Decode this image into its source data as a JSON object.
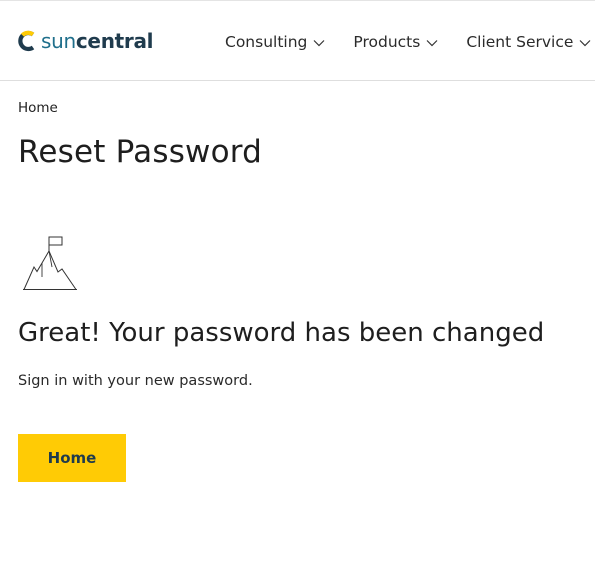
{
  "header": {
    "logo": {
      "text_sun": "sun",
      "text_central": "central",
      "colors": {
        "sun": "#1f6f8b",
        "central": "#1f3b4d",
        "mark_yellow": "#ffcb05",
        "mark_dark": "#1f3b4d"
      }
    },
    "nav": [
      {
        "label": "Consulting",
        "icon": "chevron-down-icon"
      },
      {
        "label": "Products",
        "icon": "chevron-down-icon"
      },
      {
        "label": "Client Service",
        "icon": "chevron-down-icon"
      }
    ]
  },
  "breadcrumb": {
    "home_label": "Home"
  },
  "page": {
    "title": "Reset Password",
    "illustration_icon": "mountain-flag-icon",
    "success_heading": "Great! Your password has been changed",
    "success_text": "Sign in with your new password.",
    "home_button_label": "Home",
    "accent_color": "#ffcb05"
  }
}
